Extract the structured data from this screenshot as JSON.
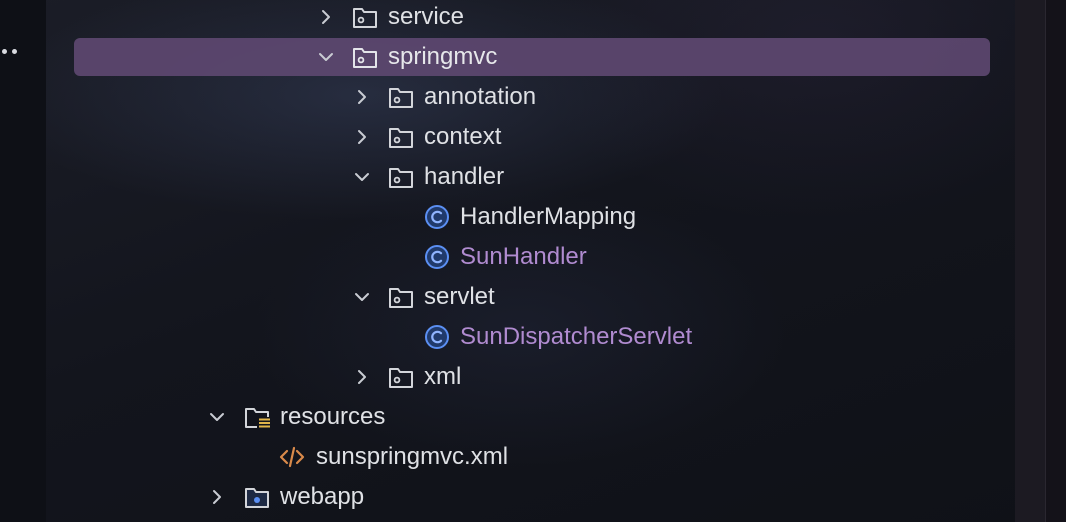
{
  "tree": {
    "rows": [
      {
        "label": "service",
        "kind": "folder",
        "expanded": false
      },
      {
        "label": "springmvc",
        "kind": "folder",
        "expanded": true,
        "selected": true
      },
      {
        "label": "annotation",
        "kind": "folder",
        "expanded": false
      },
      {
        "label": "context",
        "kind": "folder",
        "expanded": false
      },
      {
        "label": "handler",
        "kind": "folder",
        "expanded": true
      },
      {
        "label": "HandlerMapping",
        "kind": "class"
      },
      {
        "label": "SunHandler",
        "kind": "class",
        "modified": true
      },
      {
        "label": "servlet",
        "kind": "folder",
        "expanded": true
      },
      {
        "label": "SunDispatcherServlet",
        "kind": "class",
        "modified": true
      },
      {
        "label": "xml",
        "kind": "folder",
        "expanded": false
      },
      {
        "label": "resources",
        "kind": "resources-folder",
        "expanded": true
      },
      {
        "label": "sunspringmvc.xml",
        "kind": "xml-file"
      },
      {
        "label": "webapp",
        "kind": "web-folder",
        "expanded": false
      }
    ]
  },
  "colors": {
    "selection": "#5d4870",
    "text": "#dfe1e5",
    "modified_text": "#b08bd0",
    "class_icon": "#5b8ff3",
    "xml_icon": "#d98a4a",
    "resources_badge": "#e0b54a"
  },
  "icons": {
    "folder": "folder-icon",
    "class": "class-icon",
    "resources": "resources-folder-icon",
    "xml": "xml-file-icon",
    "web": "web-folder-icon",
    "chevron_right": "chevron-right-icon",
    "chevron_down": "chevron-down-icon",
    "more": "more-options-icon"
  }
}
